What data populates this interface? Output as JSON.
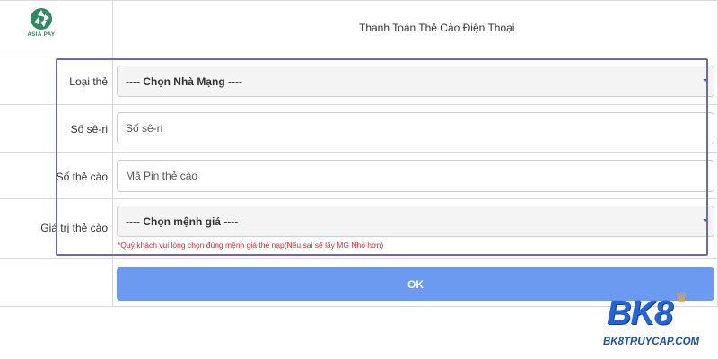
{
  "header": {
    "logo_text": "ASIA PAY",
    "title": "Thanh Toán Thẻ Cào Điện Thoại"
  },
  "form": {
    "card_type": {
      "label": "Loại thẻ",
      "selected": "---- Chọn Nhà Mạng ----"
    },
    "serial": {
      "label": "Số sê-ri",
      "placeholder": "Số sê-ri"
    },
    "pin": {
      "label": "Số thẻ cào",
      "placeholder": "Mã Pin thẻ cào"
    },
    "value": {
      "label": "Giá trị thẻ cào",
      "selected": "---- Chọn mệnh giá ----"
    },
    "note": "*Quý khách vui lòng chọn đúng mệnh giá thẻ nạp(Nếu sai sẽ lấy MG Nhỏ hơn)",
    "submit_label": "OK"
  },
  "watermark": {
    "brand": "BK8",
    "url": "BK8TRUYCAP.COM"
  },
  "colors": {
    "button": "#6c9af0",
    "highlight_border": "#6e64c4",
    "note": "#e3232b",
    "brand": "#2563d9"
  }
}
